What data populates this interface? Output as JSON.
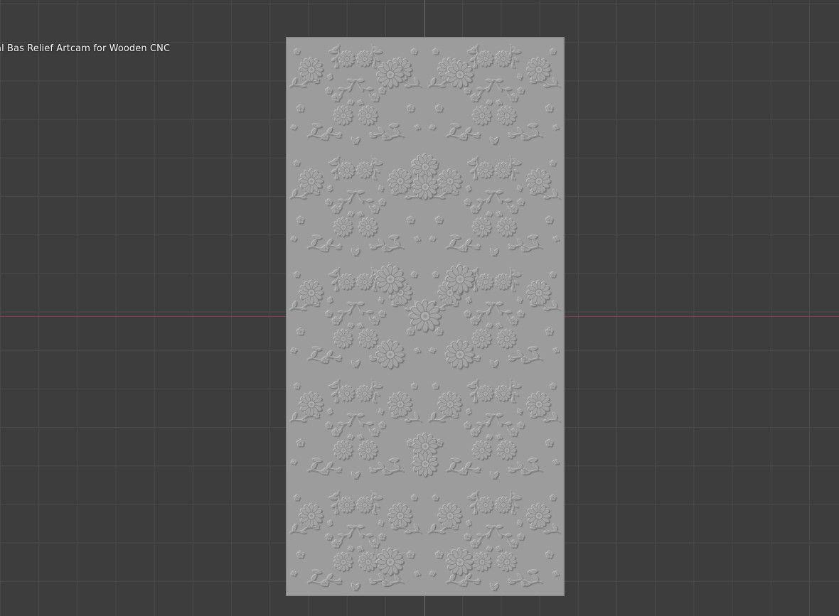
{
  "viewport": {
    "object_label": "al Bas Relief Artcam for Wooden CNC",
    "background_color": "#3d3d3d",
    "grid_color": "#4a4a4a",
    "x_axis_color": "#8c3a44",
    "y_axis_color": "#5a7a2e"
  },
  "relief": {
    "surface_color": "#9c9c9c",
    "highlight_color": "#b5b5b5",
    "shadow_color": "#7e7e7e",
    "pattern": "floral-damask"
  }
}
